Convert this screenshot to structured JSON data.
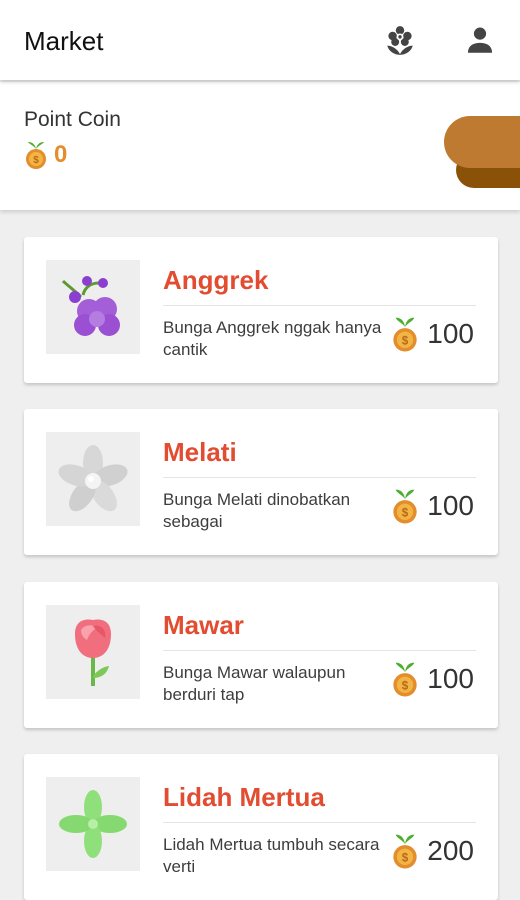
{
  "header": {
    "title": "Market",
    "flower_icon": "flower-icon",
    "user_icon": "person-icon"
  },
  "wallet": {
    "label": "Point Coin",
    "value": "0",
    "coin_icon": "coin-icon"
  },
  "colors": {
    "accent": "#e24c31",
    "coin": "#e38d2c",
    "tab": "#bd7a30",
    "tab_shadow": "#8a5209",
    "background": "#efefef"
  },
  "items": [
    {
      "name": "Anggrek",
      "description": "Bunga Anggrek nggak hanya cantik",
      "price": "100",
      "image_icon": "orchid-icon"
    },
    {
      "name": "Melati",
      "description": "Bunga Melati dinobatkan sebagai",
      "price": "100",
      "image_icon": "jasmine-icon"
    },
    {
      "name": "Mawar",
      "description": "Bunga Mawar walaupun berduri tap",
      "price": "100",
      "image_icon": "rose-icon"
    },
    {
      "name": "Lidah Mertua",
      "description": "Lidah Mertua tumbuh secara verti",
      "price": "200",
      "image_icon": "snake-plant-icon"
    }
  ]
}
